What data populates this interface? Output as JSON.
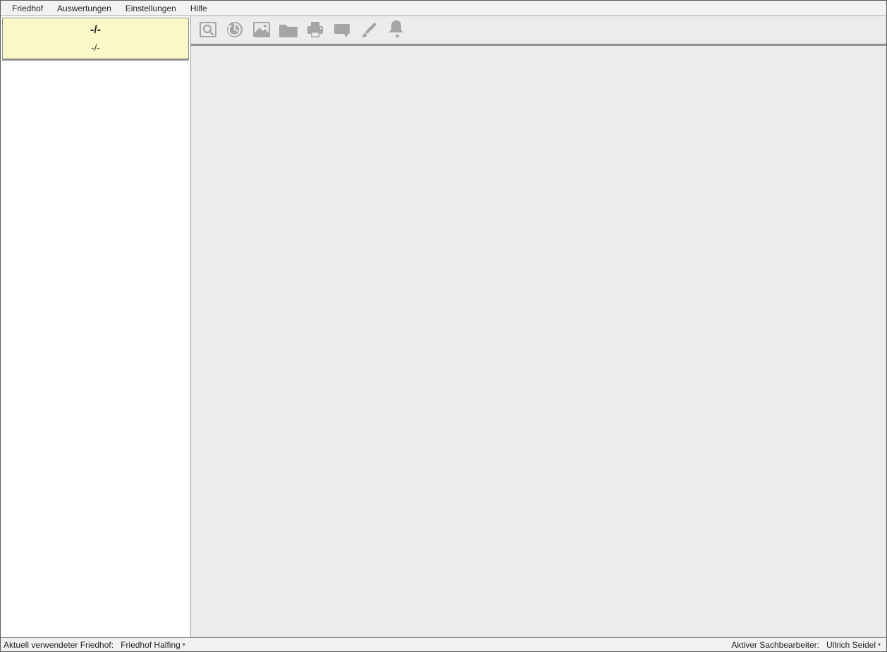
{
  "menu": {
    "items": [
      "Friedhof",
      "Auswertungen",
      "Einstellungen",
      "Hilfe"
    ]
  },
  "card": {
    "line1": "-/-",
    "line2": "-/-"
  },
  "toolbar": {
    "icons": [
      "zoom-image-icon",
      "refresh-clock-icon",
      "image-icon",
      "folder-icon",
      "print-icon",
      "tag-icon",
      "brush-icon",
      "bell-icon"
    ]
  },
  "status": {
    "left_label": "Aktuell verwendeter Friedhof:",
    "left_value": "Friedhof Halfing",
    "right_label": "Aktiver Sachbearbeiter:",
    "right_value": "Ullrich Seidel"
  }
}
